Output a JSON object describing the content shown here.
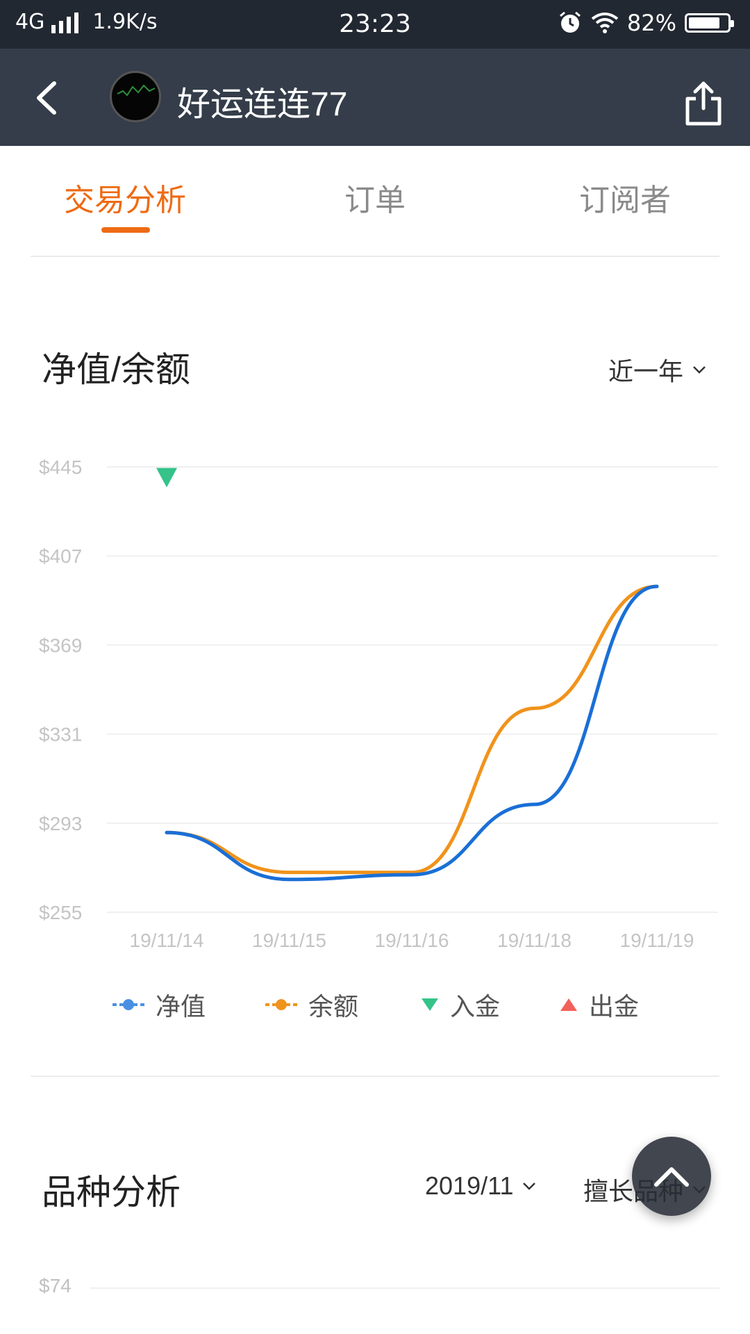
{
  "status_bar": {
    "network": "4G",
    "speed": "1.9K/s",
    "time": "23:23",
    "battery": "82%",
    "battery_level": 0.82,
    "icons": [
      "signal-icon",
      "alarm-icon",
      "wifi-icon",
      "battery-icon"
    ]
  },
  "header": {
    "title": "好运连连77",
    "back_icon": "back-arrow-icon",
    "share_icon": "share-icon"
  },
  "tabs": [
    {
      "label": "交易分析",
      "active": true
    },
    {
      "label": "订单",
      "active": false
    },
    {
      "label": "订阅者",
      "active": false
    }
  ],
  "equity_section": {
    "title": "净值/余额",
    "range_label": "近一年"
  },
  "chart_data": {
    "type": "line",
    "x": [
      "19/11/14",
      "19/11/15",
      "19/11/16",
      "19/11/18",
      "19/11/19"
    ],
    "y_ticks": [
      "$445",
      "$407",
      "$369",
      "$331",
      "$293",
      "$255"
    ],
    "ylim": [
      255,
      445
    ],
    "series": [
      {
        "name": "净值",
        "color": "#1a6fd6",
        "values": [
          289,
          269,
          271,
          301,
          394
        ]
      },
      {
        "name": "余额",
        "color": "#f0931c",
        "values": [
          289,
          272,
          272,
          342,
          394
        ]
      }
    ],
    "markers": [
      {
        "name": "入金",
        "type": "deposit",
        "x": "19/11/14",
        "y": 441,
        "color": "#35c38a"
      }
    ],
    "legend": [
      {
        "label": "净值",
        "color": "#4a90e2",
        "shape": "line-dot"
      },
      {
        "label": "余额",
        "color": "#f0931c",
        "shape": "line-dot"
      },
      {
        "label": "入金",
        "color": "#35c38a",
        "shape": "triangle-down"
      },
      {
        "label": "出金",
        "color": "#f0625a",
        "shape": "triangle-up"
      }
    ],
    "grid": true
  },
  "symbol_section": {
    "title": "品种分析",
    "month_label": "2019/11",
    "filter_label": "擅长品种",
    "first_tick": "$74"
  },
  "colors": {
    "accent": "#ee6a13",
    "header_bg": "#343d49",
    "status_bg": "#222831"
  }
}
